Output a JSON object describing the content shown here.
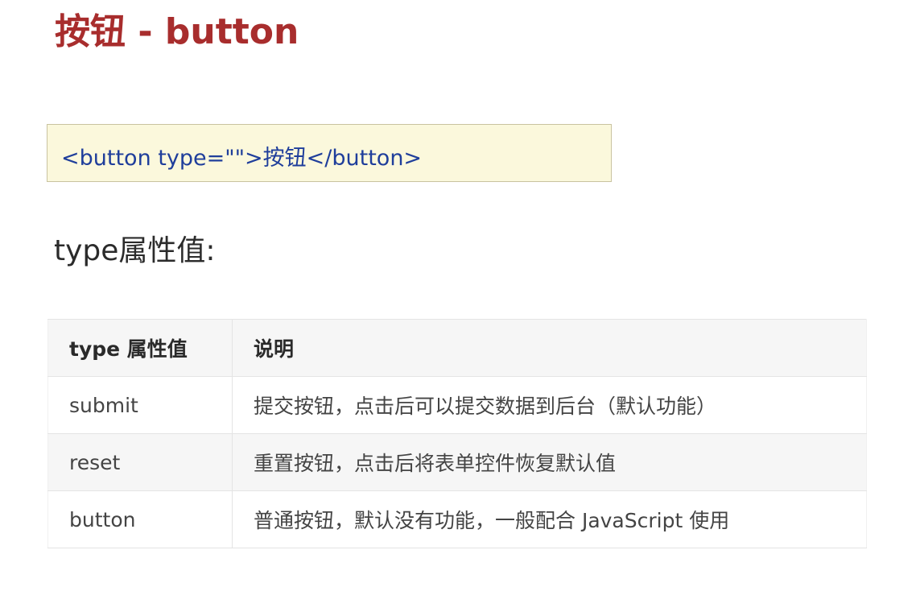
{
  "title": "按钮 - button",
  "code_snippet": "<button type=\"\">按钮</button>",
  "subheading": "type属性值:",
  "table": {
    "headers": [
      "type 属性值",
      "说明"
    ],
    "rows": [
      {
        "value": "submit",
        "description": "提交按钮，点击后可以提交数据到后台（默认功能）"
      },
      {
        "value": "reset",
        "description": "重置按钮，点击后将表单控件恢复默认值"
      },
      {
        "value": "button",
        "description": "普通按钮，默认没有功能，一般配合 JavaScript 使用"
      }
    ]
  },
  "colors": {
    "title": "#a82d2d",
    "code_text": "#1f3e9b",
    "code_background": "#fbf8dc"
  }
}
